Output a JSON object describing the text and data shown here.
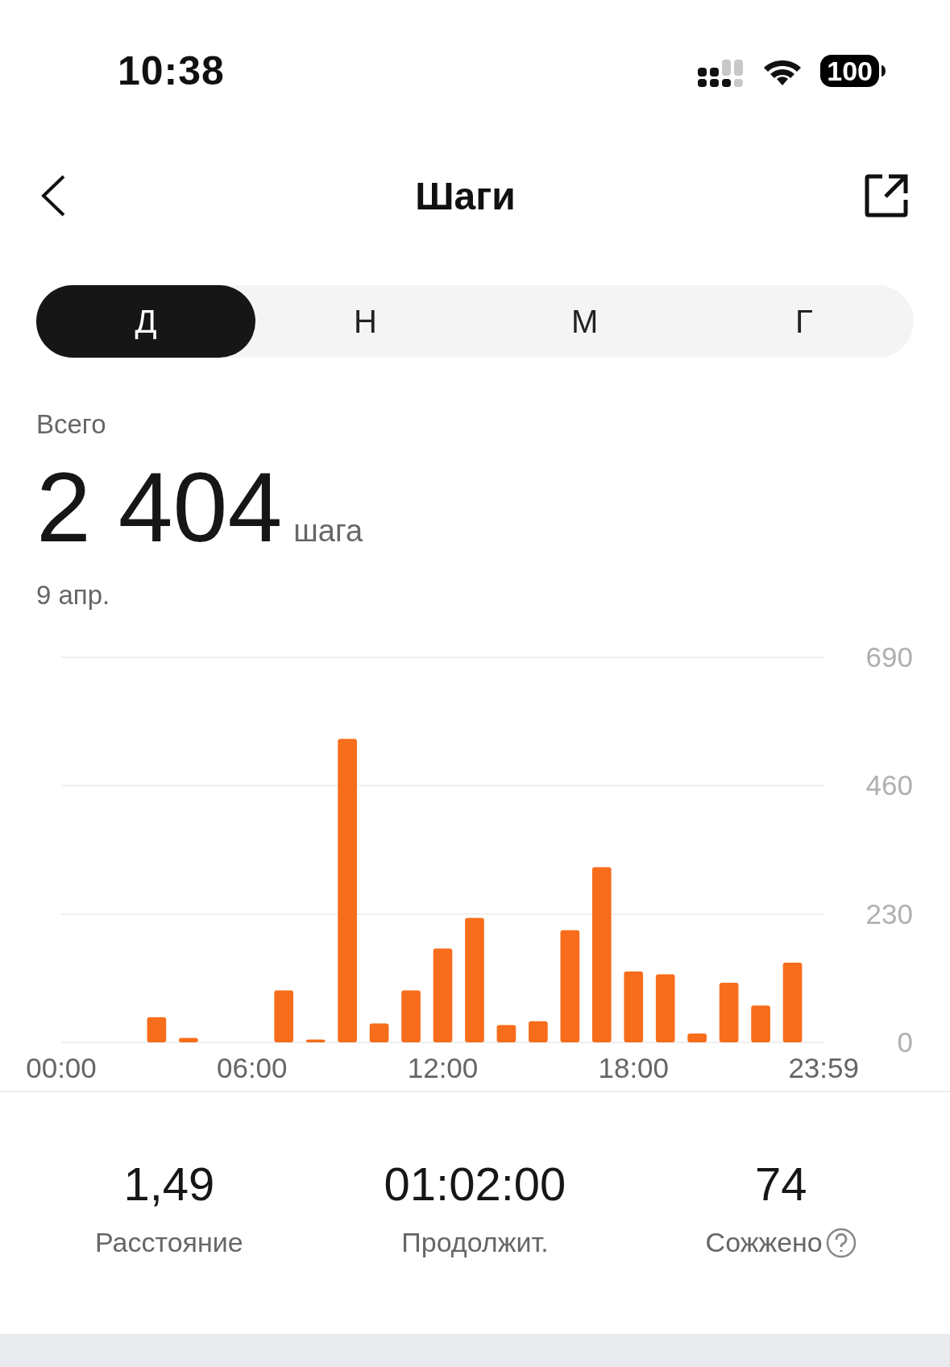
{
  "status_bar": {
    "time": "10:38",
    "battery": "100"
  },
  "nav": {
    "title": "Шаги"
  },
  "tabs": [
    {
      "label": "Д",
      "selected": true
    },
    {
      "label": "Н",
      "selected": false
    },
    {
      "label": "М",
      "selected": false
    },
    {
      "label": "Г",
      "selected": false
    }
  ],
  "summary": {
    "label": "Всего",
    "value": "2 404",
    "unit": "шага",
    "date": "9 апр."
  },
  "chart_data": {
    "type": "bar",
    "x": [
      3,
      4,
      7,
      8,
      9,
      10,
      11,
      12,
      13,
      14,
      15,
      16,
      17,
      18,
      19,
      20,
      21,
      22,
      23
    ],
    "series": [
      {
        "color": "#f76d1b",
        "values": [
          45,
          8,
          93,
          5,
          544,
          34,
          93,
          168,
          223,
          31,
          38,
          201,
          314,
          127,
          122,
          16,
          107,
          66,
          143
        ]
      }
    ],
    "xlim": [
      0,
      24
    ],
    "ylim": [
      0,
      690
    ],
    "yticks": [
      0,
      230,
      460,
      690
    ],
    "xticks": [
      {
        "value": 0,
        "label": "00:00"
      },
      {
        "value": 6,
        "label": "06:00"
      },
      {
        "value": 12,
        "label": "12:00"
      },
      {
        "value": 18,
        "label": "18:00"
      },
      {
        "value": 23.98,
        "label": "23:59"
      }
    ]
  },
  "stats": [
    {
      "value": "1,49",
      "label": "Расстояние",
      "help": false
    },
    {
      "value": "01:02:00",
      "label": "Продолжит.",
      "help": false
    },
    {
      "value": "74",
      "label": "Сожжено",
      "help": true
    }
  ]
}
